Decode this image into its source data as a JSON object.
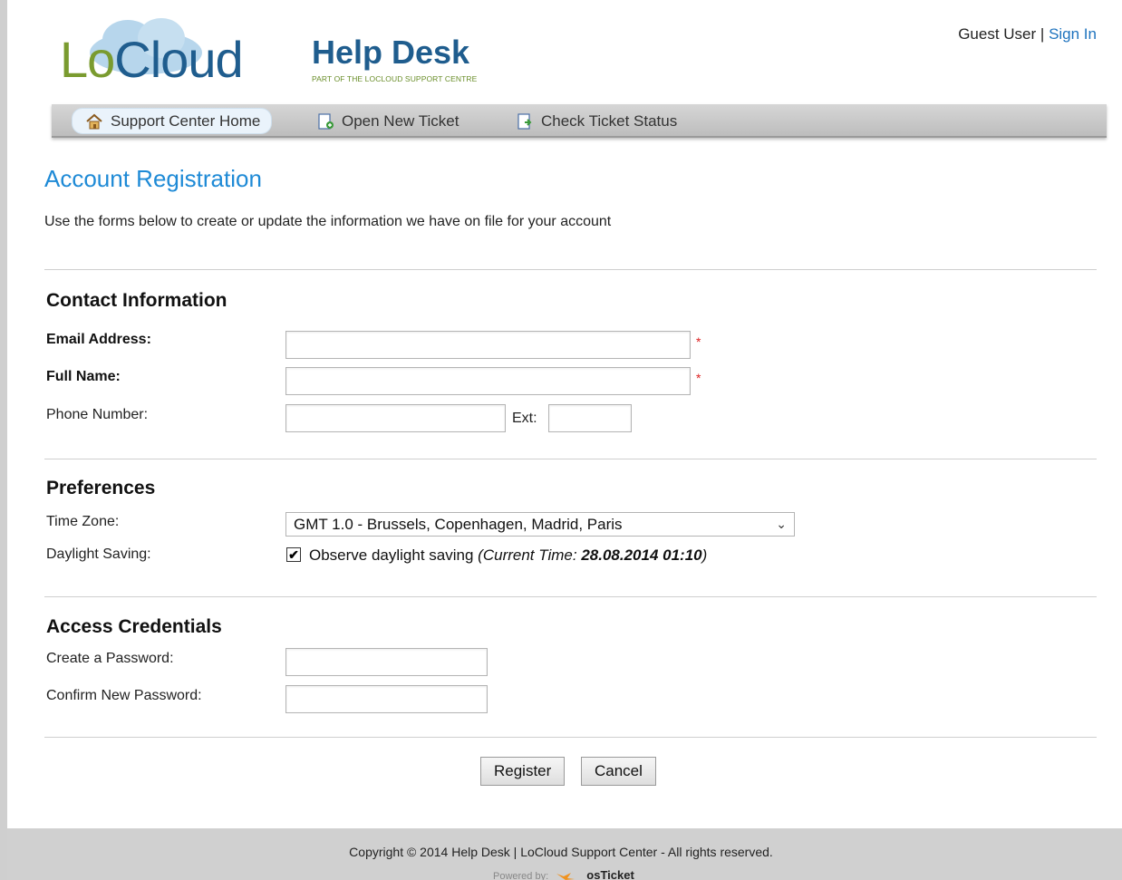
{
  "header": {
    "logo_lo": "Lo",
    "logo_cloud": "Cloud",
    "logo_helpdesk": "Help Desk",
    "logo_tagline": "PART OF THE LOCLOUD SUPPORT CENTRE",
    "user_label": "Guest User",
    "separator": "|",
    "signin_label": "Sign In"
  },
  "nav": {
    "items": [
      {
        "label": "Support Center Home",
        "icon": "home-icon"
      },
      {
        "label": "Open New Ticket",
        "icon": "new-ticket-icon"
      },
      {
        "label": "Check Ticket Status",
        "icon": "ticket-status-icon"
      }
    ]
  },
  "main": {
    "title": "Account Registration",
    "intro": "Use the forms below to create or update the information we have on file for your account"
  },
  "contact": {
    "heading": "Contact Information",
    "email_label": "Email Address:",
    "email_value": "",
    "fullname_label": "Full Name:",
    "fullname_value": "",
    "phone_label": "Phone Number:",
    "phone_value": "",
    "ext_label": "Ext:",
    "ext_value": "",
    "required_mark": "*"
  },
  "preferences": {
    "heading": "Preferences",
    "timezone_label": "Time Zone:",
    "timezone_value": "GMT 1.0 - Brussels, Copenhagen, Madrid, Paris",
    "dst_label": "Daylight Saving:",
    "dst_checked": true,
    "dst_text": "Observe daylight saving",
    "current_time_prefix": "(Current Time: ",
    "current_time_value": "28.08.2014 01:10",
    "current_time_suffix": ")"
  },
  "credentials": {
    "heading": "Access Credentials",
    "password_label": "Create a Password:",
    "confirm_label": "Confirm New Password:"
  },
  "actions": {
    "register_label": "Register",
    "cancel_label": "Cancel"
  },
  "footer": {
    "copyright": "Copyright © 2014 Help Desk | LoCloud Support Center - All rights reserved.",
    "powered_by": "Powered by:",
    "powered_brand": "osTicket"
  },
  "colors": {
    "accent_blue": "#1e8ad6",
    "link_blue": "#1e73be",
    "logo_green": "#7a9b2f",
    "logo_navy": "#1f5d8e",
    "required_red": "#d22"
  }
}
